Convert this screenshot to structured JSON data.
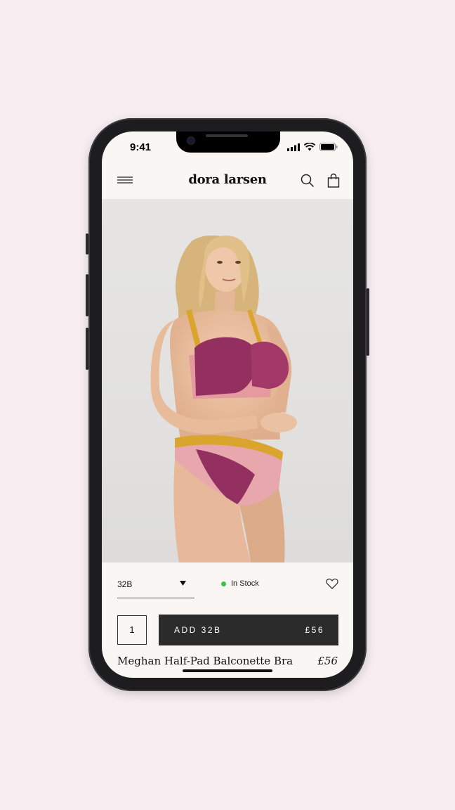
{
  "status": {
    "time": "9:41"
  },
  "header": {
    "brand": "dora larsen"
  },
  "product": {
    "size_selected": "32B",
    "stock_status": "In Stock",
    "stock_color": "#3cc24a",
    "quantity": "1",
    "add_label": "ADD 32B",
    "add_price": "£56",
    "name": "Meghan Half-Pad Balconette Bra",
    "price": "£56"
  },
  "icons": [
    "menu-icon",
    "search-icon",
    "bag-icon",
    "chevron-down-icon",
    "heart-icon",
    "signal-icon",
    "wifi-icon",
    "battery-icon"
  ],
  "colors": {
    "page_bg": "#f8eef2",
    "screen_bg": "#faf6f4",
    "button_bg": "#2b2b2b",
    "lace": "#93305f",
    "band": "#d9a52d"
  }
}
